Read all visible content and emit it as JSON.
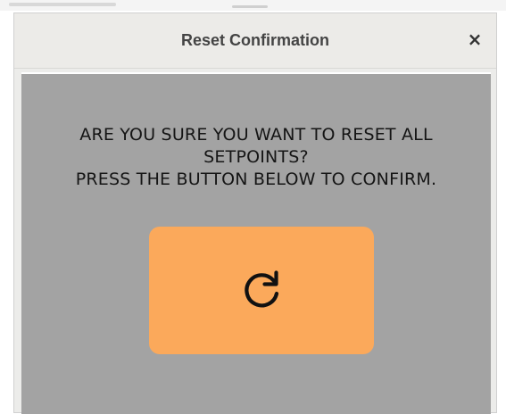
{
  "dialog": {
    "title": "Reset Confirmation",
    "close_label": "×",
    "message_line1": "ARE YOU SURE YOU WANT TO RESET ALL",
    "message_line2": "SETPOINTS?",
    "message_line3": "PRESS THE BUTTON BELOW TO CONFIRM.",
    "confirm_button": {
      "icon": "refresh-icon",
      "color": "#fba95b"
    },
    "content_background": "#a3a3a3",
    "titlebar_background": "#ecebe8"
  }
}
